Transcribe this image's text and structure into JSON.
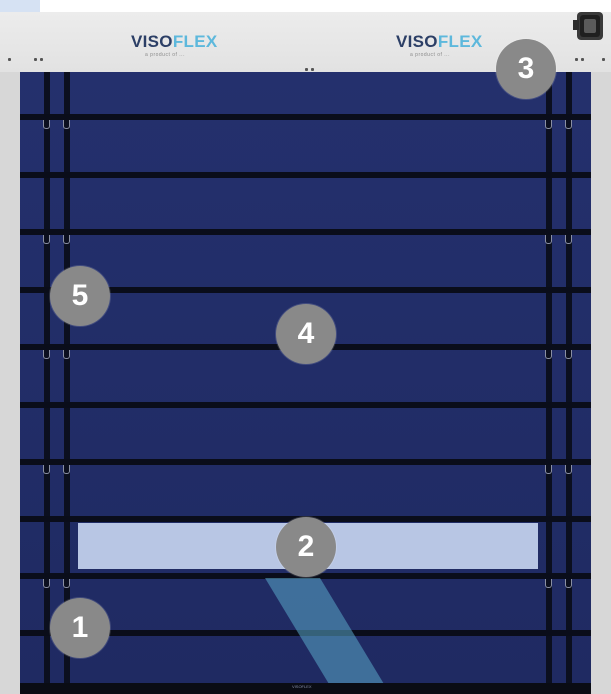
{
  "header": {
    "brands": [
      {
        "part_a": "VISO",
        "part_b": "FLEX",
        "subtitle": "a product of ..."
      },
      {
        "part_a": "VISO",
        "part_b": "FLEX",
        "subtitle": "a product of ..."
      }
    ]
  },
  "callouts": [
    {
      "label": "1"
    },
    {
      "label": "2"
    },
    {
      "label": "3"
    },
    {
      "label": "4"
    },
    {
      "label": "5"
    }
  ],
  "bottom_mark": "VISOFLEX",
  "colors": {
    "curtain": "#24306d",
    "frame": "#d7d7d7",
    "window": "#b8c6e4",
    "callout": "#898989",
    "brand_dark": "#2c3f66",
    "brand_light": "#5db8dc",
    "diagonal_band": "#5aa7c9"
  },
  "icons": {
    "motor": "motor-icon"
  }
}
